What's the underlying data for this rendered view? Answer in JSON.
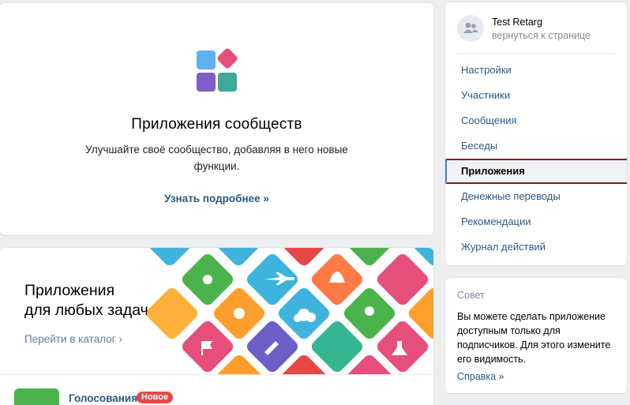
{
  "intro": {
    "title": "Приложения сообществ",
    "description": "Улучшайте своё сообщество, добавляя в него новые функции.",
    "more_link": "Узнать подробнее »",
    "logo_colors": [
      "#5fb0ee",
      "#e64e7c",
      "#7e5fc8",
      "#3daa99"
    ]
  },
  "catalog": {
    "title_line1": "Приложения",
    "title_line2": "для любых задач",
    "link": "Перейти в каталог ›",
    "tile_colors": [
      "#4bb34b",
      "#e64646",
      "#ff9e2b",
      "#3db3dd",
      "#6c5fc8",
      "#e64e7c",
      "#35b592"
    ]
  },
  "app_item": {
    "name": "Голосования",
    "badge": "Новое"
  },
  "sidebar": {
    "user_name": "Test Retarg",
    "user_back": "вернуться к странице",
    "items": [
      {
        "label": "Настройки"
      },
      {
        "label": "Участники"
      },
      {
        "label": "Сообщения"
      },
      {
        "label": "Беседы"
      },
      {
        "label": "Приложения",
        "active": true
      },
      {
        "label": "Денежные переводы"
      },
      {
        "label": "Рекомендации"
      },
      {
        "label": "Журнал действий"
      }
    ]
  },
  "tip": {
    "heading": "Совет",
    "text": "Вы можете сделать приложение доступным только для подписчиков. Для этого измените его видимость.",
    "link": "Справка »"
  }
}
